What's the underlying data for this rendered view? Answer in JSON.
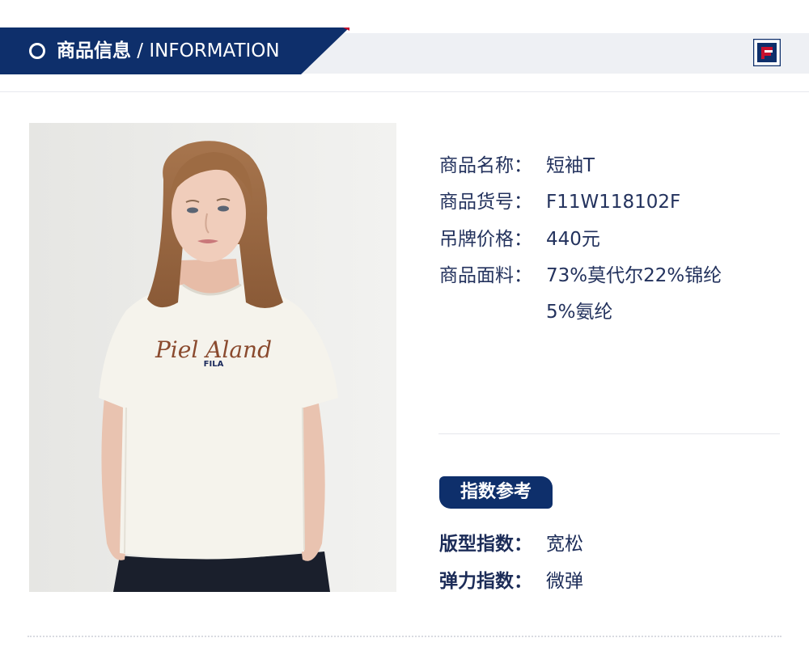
{
  "header": {
    "title_cn": "商品信息",
    "title_sep": " / ",
    "title_en": "INFORMATION",
    "logo_icon": "fila-logo-icon",
    "colors": {
      "navy": "#0e2f6b",
      "red": "#c8102e",
      "header_bg": "#eef0f4"
    }
  },
  "product_image": {
    "alt": "product-photo",
    "print_script": "Piel Aland",
    "print_brand": "FILA"
  },
  "info": [
    {
      "label": "商品名称：",
      "value": "短袖T"
    },
    {
      "label": "商品货号：",
      "value": "F11W118102F"
    },
    {
      "label": "吊牌价格：",
      "value": "440元"
    },
    {
      "label": "商品面料：",
      "value": "73%莫代尔22%锦纶"
    },
    {
      "label": "",
      "value": "5%氨纶"
    }
  ],
  "index_section": {
    "badge": "指数参考",
    "rows": [
      {
        "label": "版型指数：",
        "value": "宽松"
      },
      {
        "label": "弹力指数：",
        "value": "微弹"
      }
    ]
  }
}
